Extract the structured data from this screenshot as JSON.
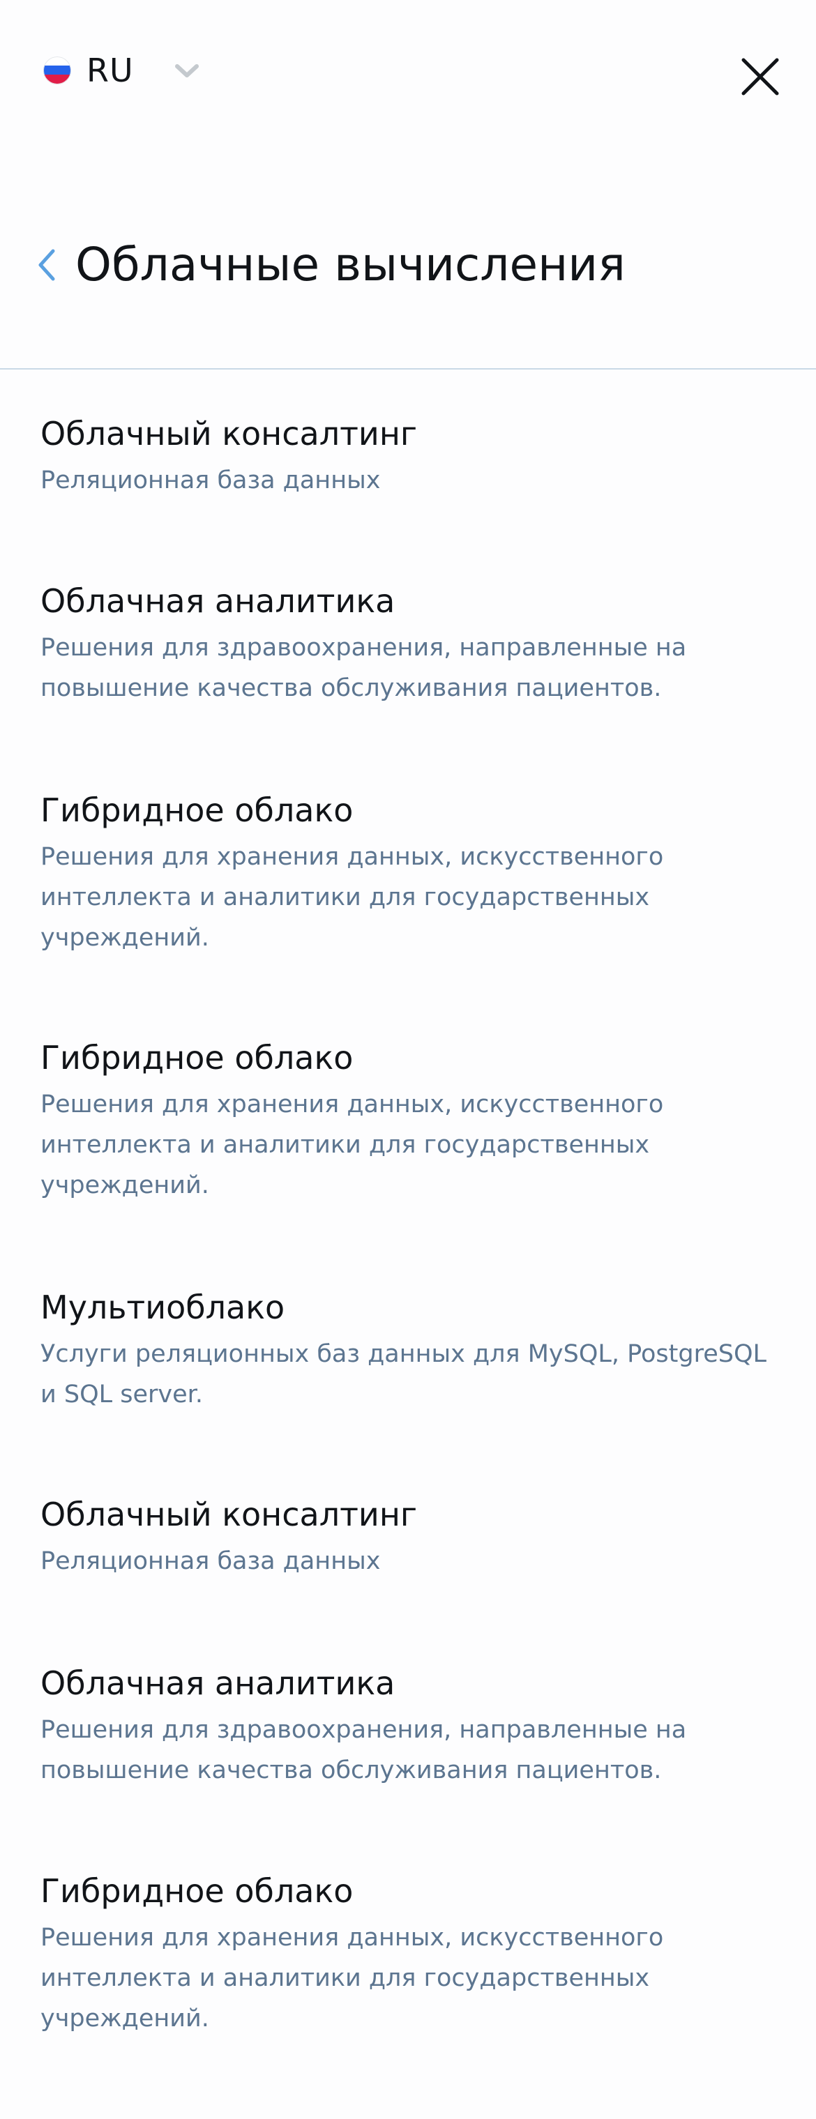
{
  "topbar": {
    "language_code": "RU",
    "flag_colors": [
      "#ffffff",
      "#2563eb",
      "#e11d48"
    ],
    "chevron_color": "#c4c9ce",
    "close_icon": "close-icon"
  },
  "header": {
    "back_icon": "chevron-left-icon",
    "back_color": "#5aa0e0",
    "title": "Облачные вычисления"
  },
  "colors": {
    "title": "#111418",
    "description": "#5c7590",
    "divider": "#c9d9e6"
  },
  "items": [
    {
      "title": "Облачный консалтинг",
      "description": "Реляционная база данных"
    },
    {
      "title": "Облачная аналитика",
      "description": "Решения для здравоохранения, направленные на повышение качества обслуживания пациентов."
    },
    {
      "title": "Гибридное облако",
      "description": "Решения для хранения данных, искусственного интеллекта и аналитики для государственных учреждений."
    },
    {
      "title": "Гибридное облако",
      "description": "Решения для хранения данных, искусственного интеллекта и аналитики для государственных учреждений."
    },
    {
      "title": "Мультиоблако",
      "description": "Услуги реляционных баз данных для MySQL, PostgreSQL и SQL server."
    },
    {
      "title": "Облачный консалтинг",
      "description": "Реляционная база данных"
    },
    {
      "title": "Облачная аналитика",
      "description": "Решения для здравоохранения, направленные на повышение качества обслуживания пациентов."
    },
    {
      "title": "Гибридное облако",
      "description": "Решения для хранения данных, искусственного интеллекта и аналитики для государственных учреждений."
    }
  ]
}
